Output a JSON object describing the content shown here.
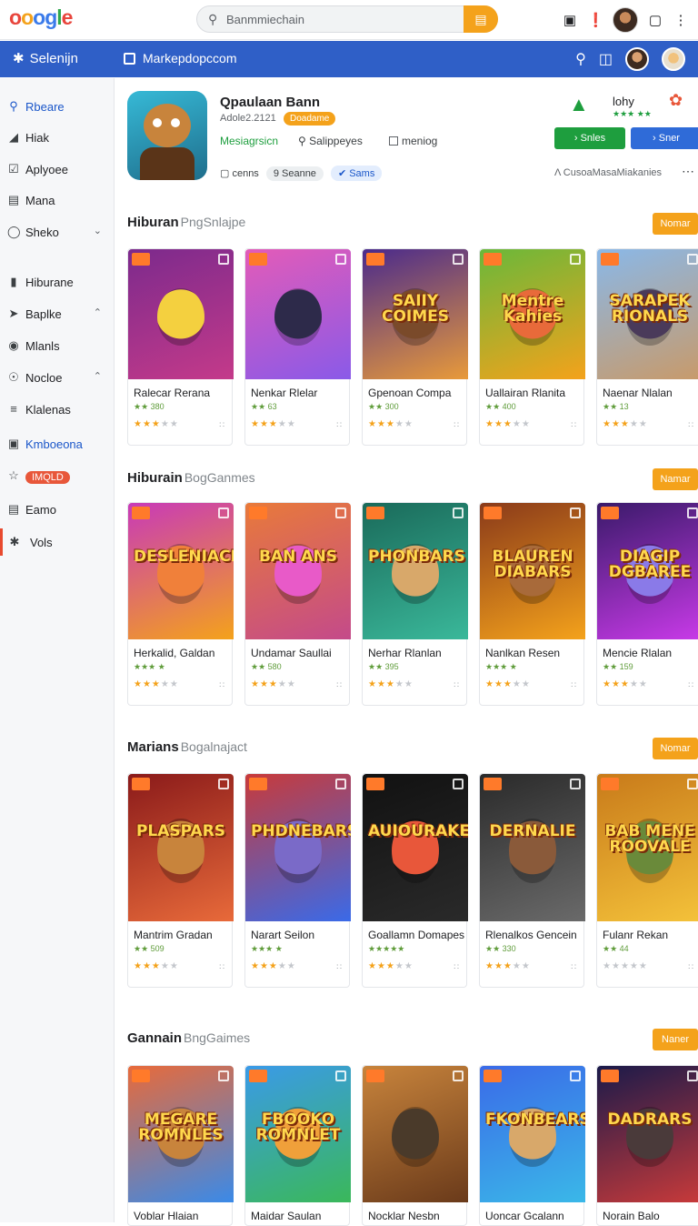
{
  "topbar": {
    "logo": "oooglle",
    "search_placeholder": "Banmmiechain",
    "icons": [
      "cart-icon",
      "alert-icon",
      "avatar",
      "window-icon",
      "more-vert-icon"
    ]
  },
  "nav": {
    "brand": "Selenijn",
    "market": "Markepdopccom"
  },
  "sidebar": {
    "items": [
      {
        "label": "Rbeare",
        "icon": "search-icon",
        "active": true
      },
      {
        "label": "Hiak",
        "icon": "tag-icon"
      },
      {
        "label": "Aplyoee",
        "icon": "check-icon"
      },
      {
        "label": "Mana",
        "icon": "window-icon"
      },
      {
        "label": "Sheko",
        "icon": "globe-icon",
        "chevron": "⌄"
      },
      {
        "label": "Hiburane",
        "icon": "bookmark-icon"
      },
      {
        "label": "Baplke",
        "icon": "send-icon",
        "chevron": "⌃"
      },
      {
        "label": "Mlanls",
        "icon": "pin-icon"
      },
      {
        "label": "Nocloe",
        "icon": "settings-icon",
        "chevron": "⌃"
      },
      {
        "label": "Klalenas",
        "icon": "list-icon"
      },
      {
        "label": "Kmboeona",
        "icon": "bag-icon",
        "blue": true
      },
      {
        "label": "IMQLD",
        "icon": "star-icon",
        "badge": true
      },
      {
        "label": "Eamo",
        "icon": "chart-icon"
      },
      {
        "label": "Vols",
        "icon": "gear-icon",
        "active_red": true
      }
    ]
  },
  "app": {
    "title": "Qpaulaan Bann",
    "date": "Adole2.2121",
    "badge": "Doadame",
    "green_link": "Mesiagrsicn",
    "option1": "Salippeyes",
    "option2": "meniog",
    "tag0": "cenns",
    "tag1": "Seanne",
    "tag2": "Sams",
    "rating_name": "lohy",
    "rating_sub": "★★★ ★★",
    "btn_green": "Snles",
    "btn_blue": "Sner",
    "customize": "CusoaMasaMiakanies"
  },
  "sections": [
    {
      "title": "Hiburan",
      "subtitle": "PngSnlajpe",
      "button": "Nomar",
      "cards": [
        {
          "name": "Ralecar Rerana",
          "meta": "★★ 380",
          "stars": 3,
          "thumb_title": "",
          "bg1": "#7c2a8c",
          "bg2": "#c43a8a",
          "mascot": "#f4d03f"
        },
        {
          "name": "Nenkar Rlelar",
          "meta": "★★ 63",
          "stars": 3,
          "thumb_title": "",
          "bg1": "#e35bb8",
          "bg2": "#8a5ae8",
          "mascot": "#2d2a4a"
        },
        {
          "name": "Gpenoan Compa",
          "meta": "★★ 300",
          "stars": 3,
          "thumb_title": "SAIIY COIMES",
          "bg1": "#4a2a8c",
          "bg2": "#e89a3a",
          "mascot": "#7a4a2a"
        },
        {
          "name": "Uallairan Rlanita",
          "meta": "★★ 400",
          "stars": 3,
          "thumb_title": "Mentre Kahies",
          "bg1": "#6ab83a",
          "bg2": "#f4a21b",
          "mascot": "#e86a3a"
        },
        {
          "name": "Naenar Nlalan",
          "meta": "★★ 13",
          "stars": 3,
          "thumb_title": "SARAPEK RIONALS",
          "bg1": "#8ab8e8",
          "bg2": "#c89a6a",
          "mascot": "#4a3a5a"
        }
      ]
    },
    {
      "title": "Hiburain",
      "subtitle": "BogGanmes",
      "button": "Namar",
      "cards": [
        {
          "name": "Herkalid, Galdan",
          "meta": "★★★ ★",
          "stars": 3,
          "thumb_title": "DESLENIACH",
          "bg1": "#c83ab8",
          "bg2": "#f4a21b",
          "mascot": "#f0803a"
        },
        {
          "name": "Undamar Saullai",
          "meta": "★★ 580",
          "stars": 3,
          "thumb_title": "BAN ANS",
          "bg1": "#e87a3a",
          "bg2": "#c44a8a",
          "mascot": "#e85ac8"
        },
        {
          "name": "Nerhar Rlanlan",
          "meta": "★★ 395",
          "stars": 3,
          "thumb_title": "PHONBARS",
          "bg1": "#1a6a5a",
          "bg2": "#3ab89a",
          "mascot": "#d8a86a"
        },
        {
          "name": "Nanlkan Resen",
          "meta": "★★★ ★",
          "stars": 3,
          "thumb_title": "BLAUREN DIABARS",
          "bg1": "#8a3a1a",
          "bg2": "#f4a21b",
          "mascot": "#a86a3a"
        },
        {
          "name": "Mencie Rlalan",
          "meta": "★★ 159",
          "stars": 3,
          "thumb_title": "DIAGIP DGBAREE",
          "bg1": "#3a1a6a",
          "bg2": "#c83ae8",
          "mascot": "#8a7ae8"
        }
      ]
    },
    {
      "title": "Marians",
      "subtitle": "Bogalnajact",
      "button": "Nomar",
      "cards": [
        {
          "name": "Mantrim Gradan",
          "meta": "★★ 509",
          "stars": 3,
          "thumb_title": "PLASPARS",
          "bg1": "#8a1a1a",
          "bg2": "#e86a3a",
          "mascot": "#c8843c"
        },
        {
          "name": "Narart Seilon",
          "meta": "★★★ ★",
          "stars": 3,
          "thumb_title": "PHDNEBARS",
          "bg1": "#c83a3a",
          "bg2": "#3a6ae8",
          "mascot": "#7a6ac8"
        },
        {
          "name": "Goallamn Domapes",
          "meta": "★★★★★",
          "stars": 3,
          "thumb_title": "AUIOURAKE",
          "bg1": "#111111",
          "bg2": "#2a2a2a",
          "mascot": "#e8573a"
        },
        {
          "name": "Rlenalkos Gencein",
          "meta": "★★ 330",
          "stars": 3,
          "thumb_title": "DERNALIE",
          "bg1": "#2a2a2a",
          "bg2": "#6a6a6a",
          "mascot": "#8a5a3a"
        },
        {
          "name": "Fulanr Rekan",
          "meta": "★★ 44",
          "stars": 0,
          "thumb_title": "BAB MENE ROOVALE",
          "bg1": "#c87a1a",
          "bg2": "#f4c23a",
          "mascot": "#6a8a3a"
        }
      ]
    },
    {
      "title": "Gannain",
      "subtitle": "BngGaimes",
      "button": "Naner",
      "cards": [
        {
          "name": "Voblar Hlaian",
          "meta": "",
          "stars": 0,
          "thumb_title": "MEGARE ROMNLES",
          "bg1": "#e86a3a",
          "bg2": "#3a8ae8",
          "mascot": "#c8843c"
        },
        {
          "name": "Maidar Saulan",
          "meta": "",
          "stars": 0,
          "thumb_title": "FBOOKO ROMNLET",
          "bg1": "#3a9ae8",
          "bg2": "#3ab85a",
          "mascot": "#f0a03a"
        },
        {
          "name": "Nocklar Nesbn",
          "meta": "",
          "stars": 0,
          "thumb_title": "",
          "bg1": "#c8843c",
          "bg2": "#6a3a1a",
          "mascot": "#4a3a2a"
        },
        {
          "name": "Uoncar Gcalann",
          "meta": "",
          "stars": 0,
          "thumb_title": "FKONBEARS",
          "bg1": "#3a6ae8",
          "bg2": "#3ab8e8",
          "mascot": "#d8a86a"
        },
        {
          "name": "Norain Balo",
          "meta": "",
          "stars": 0,
          "thumb_title": "DADRARS",
          "bg1": "#1a1a4a",
          "bg2": "#c83a3a",
          "mascot": "#4a3a3a"
        }
      ]
    }
  ]
}
